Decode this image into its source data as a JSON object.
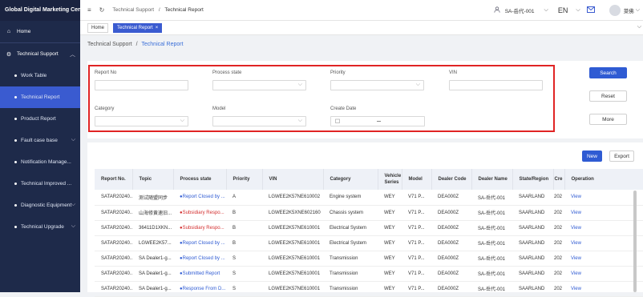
{
  "app": {
    "title": "Global Digital Marketing Center"
  },
  "sidebar": {
    "items": [
      {
        "label": "Home",
        "icon": "home-icon"
      },
      {
        "label": "Technical Support",
        "icon": "gear-icon"
      },
      {
        "label": "Work Table"
      },
      {
        "label": "Technical Report"
      },
      {
        "label": "Product Report"
      },
      {
        "label": "Fault case base"
      },
      {
        "label": "Notification Manage..."
      },
      {
        "label": "Technical Improved ..."
      },
      {
        "label": "Diagnostic Equipment"
      },
      {
        "label": "Technical Upgrade"
      }
    ]
  },
  "header": {
    "breadcrumb_parent": "Technical Support",
    "breadcrumb_sep": "/",
    "breadcrumb_current": "Technical Report",
    "dealer": "SA-岳代-001",
    "language": "EN",
    "user": "菜佛",
    "chevron": "⌵"
  },
  "tabs": [
    {
      "label": "Home"
    },
    {
      "label": "Technical Report"
    }
  ],
  "breadcrumb": {
    "parent": "Technical Support",
    "sep": "/",
    "current": "Technical Report"
  },
  "search": {
    "report_no": "Report No",
    "process_state": "Process state",
    "priority": "Priority",
    "vin": "VIN",
    "category": "Category",
    "model": "Model",
    "create_date": "Create Date"
  },
  "buttons": {
    "search": "Search",
    "reset": "Reset",
    "more": "More",
    "new": "New",
    "export": "Export"
  },
  "table": {
    "headers": [
      "Report No.",
      "Topic",
      "Process state",
      "Priority",
      "VIN",
      "Category",
      "Vehicle Series",
      "Model",
      "Dealer Code",
      "Dealer Name",
      "State/Region",
      "Cre",
      "Operation"
    ],
    "rows": [
      [
        "SATAR20240...",
        "测试随盟同步",
        "●Report Closed by ...",
        "A",
        "LGWEE2K57NE610002",
        "Engine system",
        "WEY",
        "V71 P...",
        "DEA000Z",
        "SA-岳代-001",
        "SAARLAND",
        "202",
        "View"
      ],
      [
        "SATAR20240...",
        "山海修黄速旧...",
        "●Subsidiary Respo...",
        "B",
        "LGWEE2K5XNE602160",
        "Chassis system",
        "WEY",
        "V71 P...",
        "DEA000Z",
        "SA-岳代-001",
        "SAARLAND",
        "202",
        "View"
      ],
      [
        "SATAR20240...",
        "36411D1XKN...",
        "●Subsidiary Respo...",
        "B",
        "LGWEE2K57NE610001",
        "Electrical System",
        "WEY",
        "V71 P...",
        "DEA000Z",
        "SA-岳代-001",
        "SAARLAND",
        "202",
        "View"
      ],
      [
        "SATAR20240...",
        "LGWEE2K57...",
        "●Report Closed by ...",
        "B",
        "LGWEE2K57NE610001",
        "Electrical System",
        "WEY",
        "V71 P...",
        "DEA000Z",
        "SA-岳代-001",
        "SAARLAND",
        "202",
        "View"
      ],
      [
        "SATAR20240...",
        "SA Dealer1-g...",
        "●Report Closed by ...",
        "S",
        "LGWEE2K57NE610001",
        "Transmission",
        "WEY",
        "V71 P...",
        "DEA000Z",
        "SA-岳代-001",
        "SAARLAND",
        "202",
        "View"
      ],
      [
        "SATAR20240...",
        "SA Dealer1-g...",
        "●Submitted Report",
        "S",
        "LGWEE2K57NE610001",
        "Transmission",
        "WEY",
        "V71 P...",
        "DEA000Z",
        "SA-岳代-001",
        "SAARLAND",
        "202",
        "View"
      ],
      [
        "SATAR20240...",
        "SA Dealer1-g...",
        "●Response From D...",
        "S",
        "LGWEE2K57NE610001",
        "Transmission",
        "WEY",
        "V71 P...",
        "DEA000Z",
        "SA-岳代-001",
        "SAARLAND",
        "202",
        "View"
      ]
    ]
  },
  "colors": {
    "sidebar": "#1e2a4a",
    "accent": "#2f5bd3",
    "highlight": "#e02424"
  }
}
